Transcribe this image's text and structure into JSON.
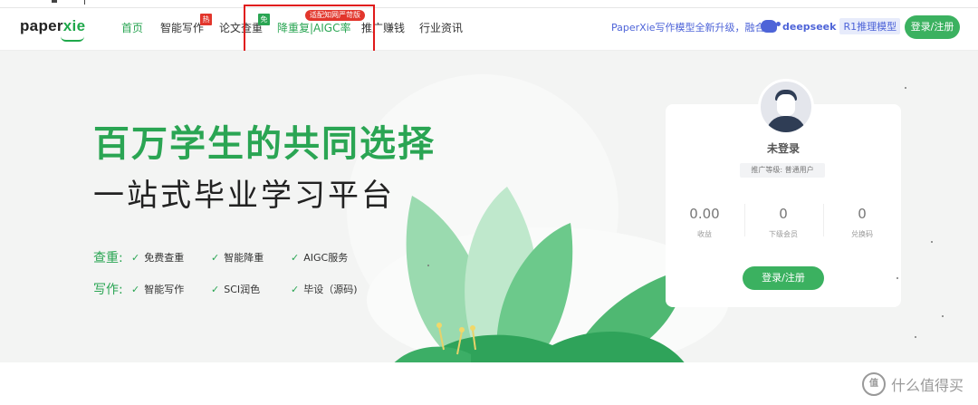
{
  "brand": {
    "logo_prefix": "paper",
    "logo_suffix": "xie"
  },
  "nav": {
    "items": [
      {
        "label": "首页"
      },
      {
        "label": "智能写作",
        "badge": "热"
      },
      {
        "label": "论文查重",
        "badge": "免"
      },
      {
        "label": "降重复|AIGC率",
        "badge": "适配知网严苛版"
      },
      {
        "label": "推广赚钱"
      },
      {
        "label": "行业资讯"
      }
    ]
  },
  "promo": {
    "text": "PaperXie写作模型全新升级，融合",
    "partner": "deepseek",
    "model": "R1推理模型"
  },
  "header": {
    "login_label": "登录/注册"
  },
  "hero": {
    "title": "百万学生的共同选择",
    "subtitle": "一站式毕业学习平台",
    "rows": [
      {
        "category": "查重:",
        "features": [
          "免费查重",
          "智能降重",
          "AIGC服务"
        ]
      },
      {
        "category": "写作:",
        "features": [
          "智能写作",
          "SCI润色",
          "毕设（源码)"
        ]
      }
    ]
  },
  "user_card": {
    "username": "未登录",
    "level": "推广等级: 普通用户",
    "stats": [
      {
        "value": "0.00",
        "label": "收益"
      },
      {
        "value": "0",
        "label": "下级会员"
      },
      {
        "value": "0",
        "label": "兑换码"
      }
    ],
    "login_label": "登录/注册"
  },
  "watermark": {
    "icon_text": "值",
    "text": "什么值得买"
  },
  "colors": {
    "brand_green": "#2aa553",
    "button_green": "#3bb160",
    "hot_red": "#e2362c",
    "promo_blue": "#4e64d8",
    "annotation_red": "#e01a1a"
  }
}
